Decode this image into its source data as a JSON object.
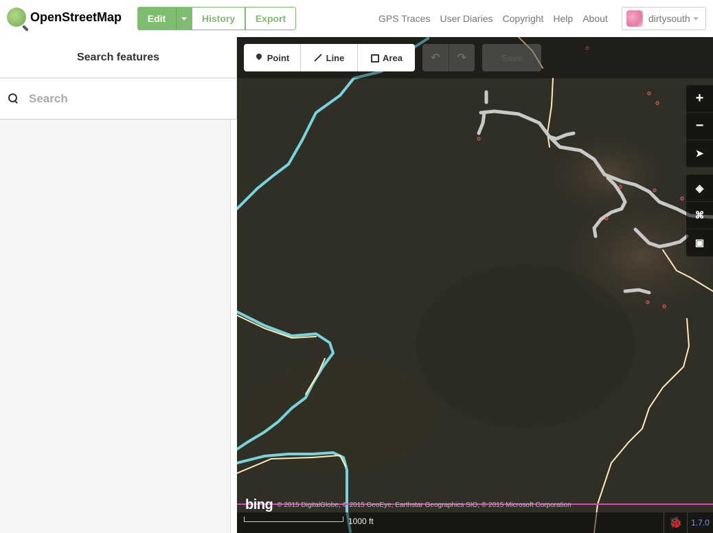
{
  "app": {
    "logo_text": "OpenStreetMap"
  },
  "topbar": {
    "edit_label": "Edit",
    "history_label": "History",
    "export_label": "Export",
    "nav": [
      "GPS Traces",
      "User Diaries",
      "Copyright",
      "Help",
      "About"
    ],
    "username": "dirtysouth"
  },
  "sidebar": {
    "header": "Search features",
    "search_placeholder": "Search"
  },
  "map": {
    "modes": {
      "point": "Point",
      "line": "Line",
      "area": "Area"
    },
    "save_label": "Save",
    "attribution_logo": "bing",
    "attribution": "© 2015 DigitalGlobe, © 2015 GeoEye, Earthstar Geographics SIO, © 2015 Microsoft Corporation",
    "scale_label": "1000 ft",
    "version": "1.7.0"
  },
  "colors": {
    "brand_green": "#7ebc6f",
    "waterway": "#77d3de",
    "track": "#c5b59f",
    "road": "#ffffff",
    "version_link": "#7092ff"
  }
}
